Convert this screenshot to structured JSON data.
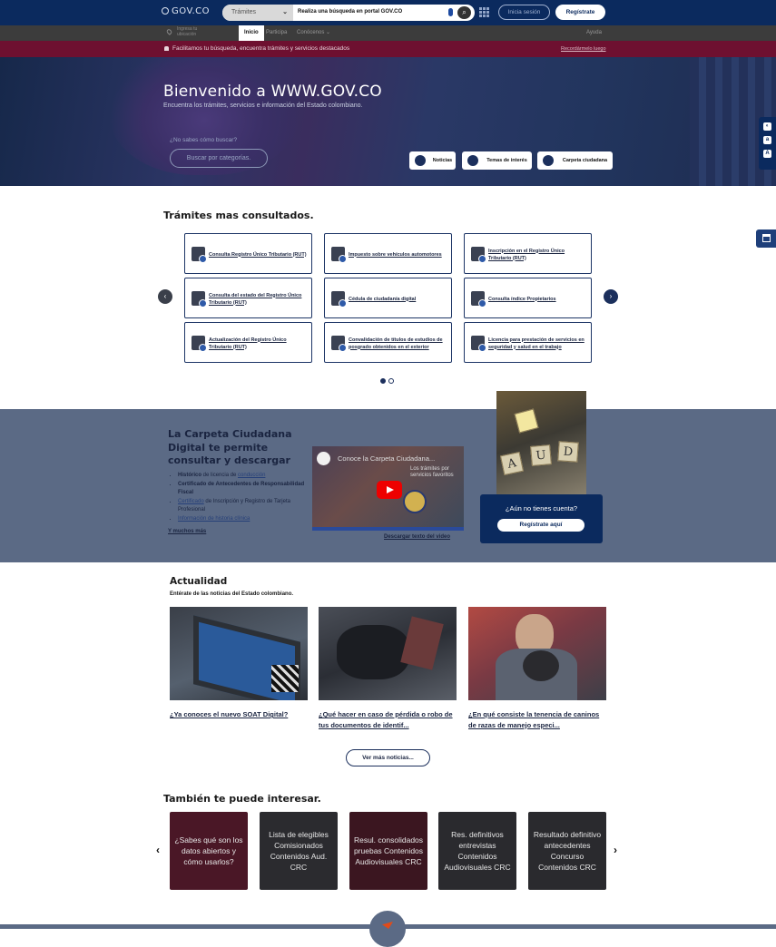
{
  "header": {
    "logo": "GOV.CO",
    "search_category": "Trámites",
    "search_placeholder": "Realiza una búsqueda en portal GOV.CO",
    "login": "Inicia sesión",
    "register": "Regístrate"
  },
  "nav": {
    "location_line1": "Ingresa tu",
    "location_line2": "ubicación",
    "tabs": [
      "Inicio",
      "Participa",
      "Conócenos"
    ],
    "help": "Ayuda"
  },
  "alert": {
    "message": "Facilitamos tu búsqueda, encuentra trámites y servicios destacados",
    "dismiss": "Recordármelo luego"
  },
  "hero": {
    "title": "Bienvenido a WWW.GOV.CO",
    "subtitle": "Encuentra los trámites, servicios e información del Estado colombiano.",
    "question": "¿No sabes cómo buscar?",
    "category_button": "Buscar por categorías.",
    "shortcuts": [
      "Noticias",
      "Temas de interés",
      "Carpeta ciudadana"
    ]
  },
  "tramites": {
    "title": "Trámites mas consultados.",
    "cards": [
      "Consulta Registro Único Tributario (RUT)",
      "Impuesto sobre vehículos automotores",
      "Inscripción en el Registro Único Tributario (RUT)",
      "Consulta del estado del Registro Único Tributario (RUT)",
      "Cédula de ciudadanía digital",
      "Consulta índice Propietarios",
      "Actualización del Registro Único Tributario (RUT)",
      "Convalidación de títulos de estudios de posgrado obtenidos en el exterior",
      "Licencia para prestación de servicios en seguridad y salud en el trabajo"
    ]
  },
  "carpeta": {
    "title": "La Carpeta Ciudadana Digital te permite consultar y descargar",
    "items": [
      {
        "bold": "Histórico",
        "text": " de licencia de ",
        "link": "conducción"
      },
      {
        "bold": "Certificado de Antecedentes de Responsabilidad Fiscal",
        "text": "",
        "link": ""
      },
      {
        "bold": "",
        "text": " de Inscripción y Registro de Tarjeta Profesional",
        "link": "Certificado"
      },
      {
        "bold": "",
        "text": "",
        "link": "Información de historia clínica"
      }
    ],
    "more": "Y muchos más",
    "video_title": "Conoce la Carpeta Ciudadana...",
    "video_caption": "Los trámites por servicios favoritos",
    "video_text_link": "Descargar texto del video",
    "tiles": [
      "A",
      "U",
      "D"
    ],
    "cta_question": "¿Aún no tienes cuenta?",
    "cta_button": "Regístrate aquí"
  },
  "actualidad": {
    "title": "Actualidad",
    "subtitle": "Entérate de las noticias del Estado colombiano.",
    "news": [
      "¿Ya conoces el nuevo SOAT Digital?",
      "¿Qué hacer en caso de pérdida o robo de tus documentos de identif...",
      "¿En qué consiste la tenencia de caninos de razas de manejo especi..."
    ],
    "more_button": "Ver más noticias..."
  },
  "interes": {
    "title": "También te puede interesar.",
    "cards": [
      "¿Sabes qué son los datos abiertos y cómo usarlos?",
      "Lista de elegibles Comisionados Contenidos Aud. CRC",
      "Resul. consolidados pruebas Contenidos Audiovisuales CRC",
      "Res. definitivos entrevistas Contenidos Audiovisuales CRC",
      "Resultado definitivo antecedentes Concurso Contenidos CRC"
    ]
  },
  "colors": {
    "primary": "#0b2a5e",
    "alert": "#6e1030",
    "band": "#5b6a85"
  }
}
